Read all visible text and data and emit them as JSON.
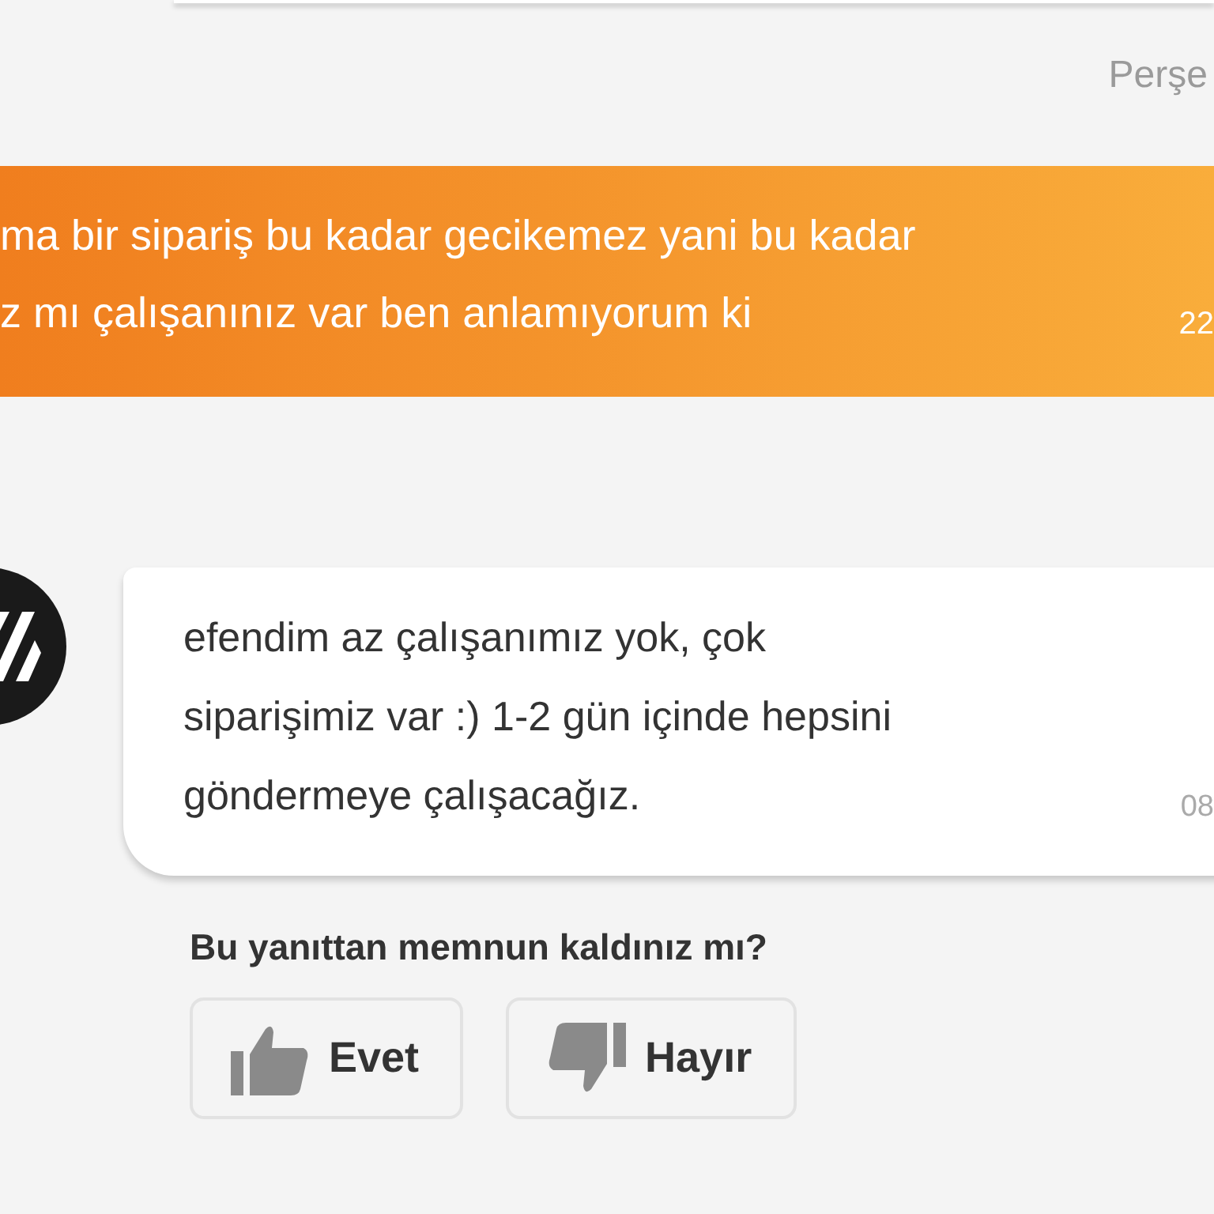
{
  "date_label": "Perşe",
  "messages": [
    {
      "kind": "sent",
      "lines": [
        "ma bir sipariş bu kadar gecikemez yani bu kadar",
        "z mı çalışanınız var ben anlamıyorum ki"
      ],
      "time": "22"
    },
    {
      "kind": "received",
      "lines": [
        "efendim az çalışanımız yok, çok",
        "siparişimiz var :) 1-2 gün içinde hepsini",
        "göndermeye çalışacağız."
      ],
      "time": "08"
    }
  ],
  "feedback": {
    "question": "Bu yanıttan memnun kaldınız mı?",
    "buttons": [
      {
        "kind": "yes",
        "label": "Evet"
      },
      {
        "kind": "no",
        "label": "Hayır"
      }
    ]
  }
}
